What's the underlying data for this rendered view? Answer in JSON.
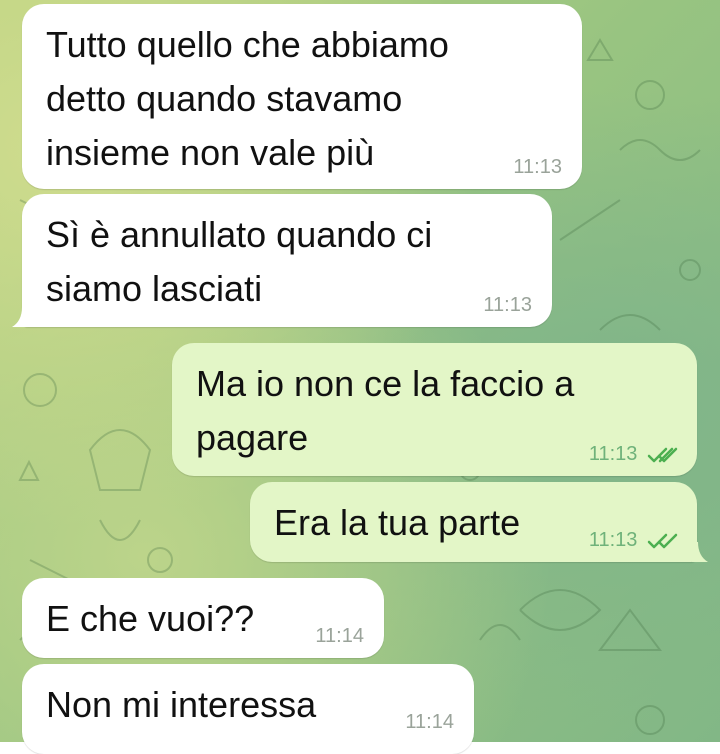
{
  "chat": {
    "accent_outgoing": "#e3f6c7",
    "accent_incoming": "#ffffff",
    "read_check_color": "#4caf50",
    "messages": [
      {
        "direction": "incoming",
        "lines": [
          "Tutto quello che abbiamo",
          "detto quando stavamo",
          "insieme non vale più"
        ],
        "time": "11:13"
      },
      {
        "direction": "incoming",
        "lines": [
          "Sì è annullato quando ci",
          "siamo lasciati"
        ],
        "time": "11:13"
      },
      {
        "direction": "outgoing",
        "lines": [
          "Ma io non ce la faccio a",
          "pagare"
        ],
        "time": "11:13",
        "status": "read"
      },
      {
        "direction": "outgoing",
        "lines": [
          "Era la tua parte"
        ],
        "time": "11:13",
        "status": "read"
      },
      {
        "direction": "incoming",
        "lines": [
          "E che vuoi??"
        ],
        "time": "11:14"
      },
      {
        "direction": "incoming",
        "lines": [
          "Non mi interessa"
        ],
        "time": "11:14"
      }
    ]
  }
}
